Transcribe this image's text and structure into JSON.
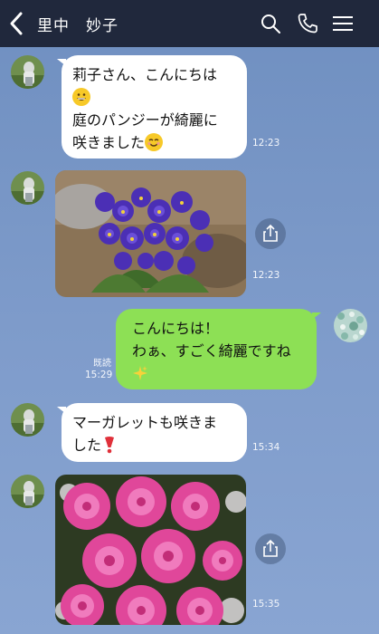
{
  "header": {
    "title": "里中　妙子"
  },
  "messages": [
    {
      "lines": [
        "莉子さん、こんにちは",
        "庭のパンジーが綺麗に",
        "咲きました"
      ],
      "time": "12:23"
    },
    {
      "image": "pansy-photo",
      "time": "12:23"
    },
    {
      "lines": [
        "こんにちは！",
        "わぁ、すごく綺麗ですね"
      ],
      "read": "既読",
      "time": "15:29"
    },
    {
      "lines": [
        "マーガレットも咲きま",
        "した"
      ],
      "time": "15:34"
    },
    {
      "image": "marguerite-photo",
      "time": "15:35"
    }
  ],
  "icons": {
    "back": "chevron-left-icon",
    "search": "search-icon",
    "call": "phone-icon",
    "menu": "hamburger-menu-icon",
    "share": "share-icon",
    "emoji1": "grinning-face-emoji",
    "emoji2": "smiling-face-emoji",
    "emoji3": "sparkles-emoji",
    "emoji4": "red-exclamation-emoji"
  },
  "colors": {
    "header": "#20283c",
    "background": "#7f9bc6",
    "incoming": "#ffffff",
    "outgoing": "#8de055"
  }
}
